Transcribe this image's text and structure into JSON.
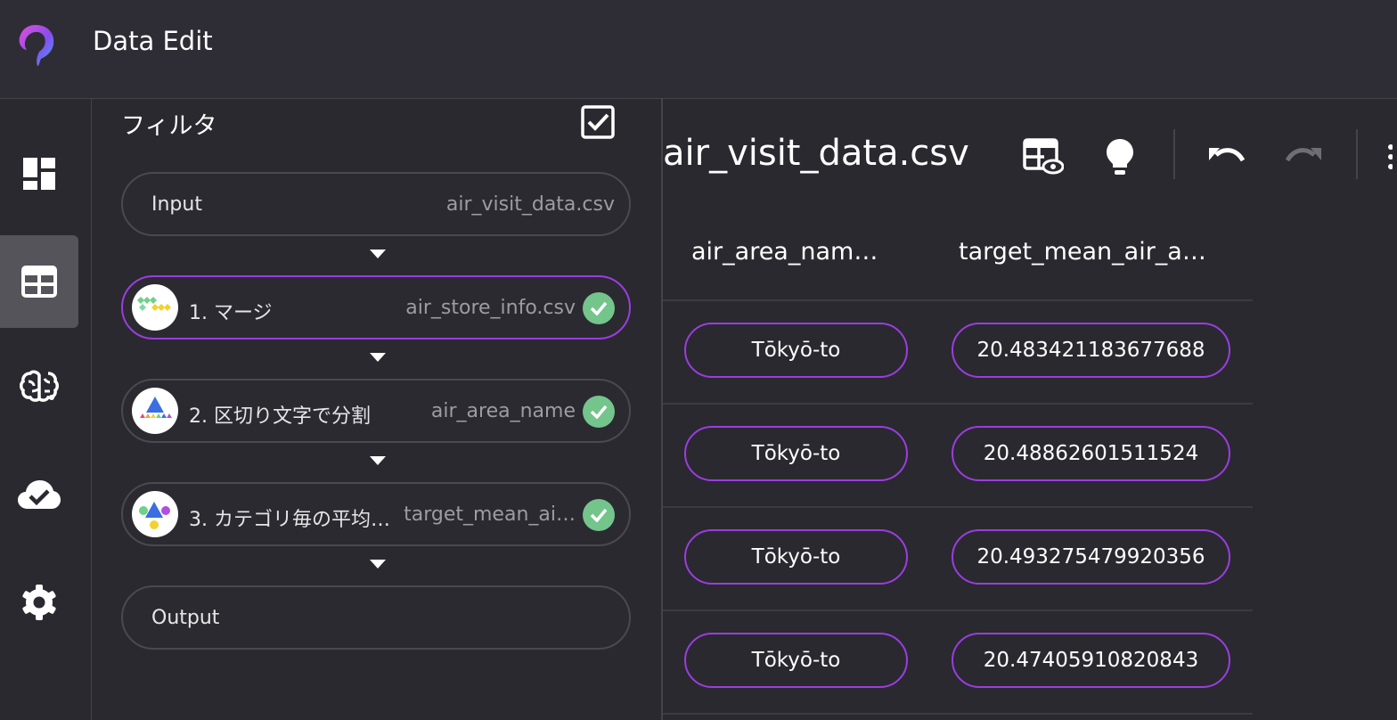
{
  "app": {
    "title": "Data Edit"
  },
  "sidebar": {
    "items": [
      {
        "name": "dashboard",
        "icon": "dashboard-icon"
      },
      {
        "name": "data-table",
        "icon": "table-icon",
        "active": true
      },
      {
        "name": "ai",
        "icon": "brain-icon"
      },
      {
        "name": "cloud",
        "icon": "cloud-check-icon"
      },
      {
        "name": "settings",
        "icon": "gear-icon"
      }
    ]
  },
  "filter": {
    "title": "フィルタ",
    "input": {
      "label": "Input",
      "file": "air_visit_data.csv"
    },
    "steps": [
      {
        "label": "1. マージ",
        "file": "air_store_info.csv",
        "status": "done",
        "selected": true,
        "icon": "merge-icon"
      },
      {
        "label": "2. 区切り文字で分割",
        "file": "air_area_name",
        "status": "done",
        "selected": false,
        "icon": "split-icon"
      },
      {
        "label": "3. カテゴリ毎の平均…",
        "file": "target_mean_ai…",
        "status": "done",
        "selected": false,
        "icon": "category-mean-icon"
      }
    ],
    "output": {
      "label": "Output"
    }
  },
  "main": {
    "file_title": "air_visit_data.csv",
    "toolbar": [
      "table-view-icon",
      "lightbulb-icon",
      "undo-icon",
      "redo-icon",
      "more-vert-icon"
    ],
    "columns": [
      "air_area_nam…",
      "target_mean_air_a…"
    ],
    "rows": [
      [
        "Tōkyō-to",
        "20.483421183677688"
      ],
      [
        "Tōkyō-to",
        "20.48862601511524"
      ],
      [
        "Tōkyō-to",
        "20.493275479920356"
      ],
      [
        "Tōkyō-to",
        "20.47405910820843"
      ]
    ]
  },
  "colors": {
    "accent": "#9b3de0",
    "success": "#74c58c",
    "background": "#2a2930"
  }
}
